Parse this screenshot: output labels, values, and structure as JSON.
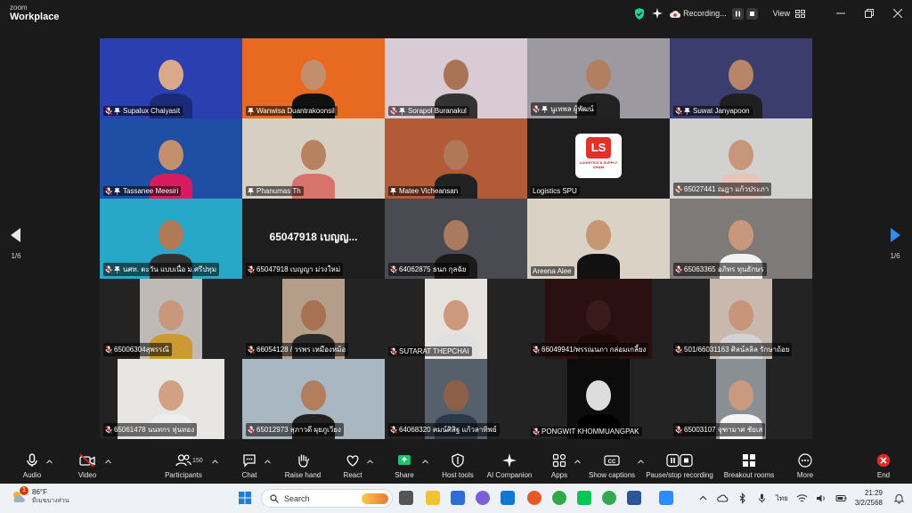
{
  "app": {
    "logo_line1": "zoom",
    "logo_line2": "Workplace"
  },
  "top": {
    "recording_label": "Recording...",
    "view_label": "View"
  },
  "nav": {
    "page_left": "1/6",
    "page_right": "1/6"
  },
  "participants": [
    {
      "name": "Supalux Chaiyasit",
      "muted": true,
      "bg": "#2a3fb0"
    },
    {
      "name": "Wanwisa Duantrakoonsil",
      "muted": false,
      "bg": "#e86a21"
    },
    {
      "name": "Sorapol Buranakul",
      "muted": true,
      "bg": "#d9cbd4"
    },
    {
      "name": "นูเทพล ผู้พัฒน์",
      "muted": true,
      "bg": "#9c9aa0"
    },
    {
      "name": "Suwat Janyapoon",
      "muted": true,
      "bg": "#3a3d6d"
    },
    {
      "name": "Tassanee Meesiri",
      "muted": true,
      "bg": "#1f4fa5"
    },
    {
      "name": "Phanumas Th",
      "muted": false,
      "bg": "#d8cfc3"
    },
    {
      "name": "Matee Vicheansan",
      "muted": false,
      "bg": "#b35b36"
    },
    {
      "name": "Logistics SPU",
      "muted": false,
      "bg": "#1e1e1e"
    },
    {
      "name": "65027441 ณฎา แก้วประภา",
      "muted": true,
      "bg": "#d1d2d0"
    },
    {
      "name": "นศท. ตะวัน แบบเนื่อ ม.ศรีปทุม",
      "muted": true,
      "bg": "#28a8c9"
    },
    {
      "name": "65047918 เบญญา ม่วงใหม่",
      "muted": true,
      "bg": "#1e1e1e"
    },
    {
      "name": "64062875 ธนภ กุลฉัย",
      "muted": true,
      "bg": "#4a4a52"
    },
    {
      "name": "Areena Alee",
      "muted": false,
      "bg": "#d9d2c5"
    },
    {
      "name": "65063365 อภิทร ทุนธักษร",
      "muted": true,
      "bg": "#7d7a78"
    },
    {
      "name": "65006304สุพรรณี",
      "muted": true,
      "bg": "#bfbab5"
    },
    {
      "name": "66054128 / วรพร เหมืองหม้อ",
      "muted": true,
      "bg": "#b49e8a"
    },
    {
      "name": "SUTARAT THEPCHAI",
      "muted": true,
      "bg": "#e6e2de"
    },
    {
      "name": "66049941/พรรณนภา กล่อมเกลี้ยง",
      "muted": true,
      "bg": "#2a1010"
    },
    {
      "name": "501/66031163 ศิลน์ลลิล รักษาถ้อย",
      "muted": true,
      "bg": "#c8b8ae"
    },
    {
      "name": "65061478 นนทกร หุ่นทอง",
      "muted": true,
      "bg": "#e8e6e2"
    },
    {
      "name": "65012973 สุภาวดี ผุยภูเวียง",
      "muted": true,
      "bg": "#a8b7c2"
    },
    {
      "name": "64068320 คมน์ศิสิฐ แก้วลาทิพย์",
      "muted": true,
      "bg": "#55606a"
    },
    {
      "name": "PONGWIT KHOMMUANGPAK",
      "muted": true,
      "bg": "#0c0c0c"
    },
    {
      "name": "65003107 จุฑามาศ ชัยเส",
      "muted": true,
      "bg": "#8a8f96"
    }
  ],
  "tiles_text": {
    "big_name": "65047918 เบญญ..."
  },
  "ls_logo": {
    "mark": "LS",
    "text": "LOGISTICS & SUPPLY CHAIN"
  },
  "toolbar": {
    "audio": "Audio",
    "video": "Video",
    "participants": "Participants",
    "participants_count": "150",
    "chat": "Chat",
    "raise_hand": "Raise hand",
    "react": "React",
    "share": "Share",
    "host_tools": "Host tools",
    "ai_companion": "AI Companion",
    "apps": "Apps",
    "show_captions": "Show captions",
    "pause_recording": "Pause/stop recording",
    "breakout_rooms": "Breakout rooms",
    "more": "More",
    "end": "End"
  },
  "taskbar": {
    "temp": "86°F",
    "weather_desc": "มีเมฆบางส่วน",
    "badge": "1",
    "search": "Search",
    "lang": "ไทย",
    "time": "21:29",
    "date": "3/2/2568"
  },
  "colors": {
    "accent_green": "#23d18b",
    "end_red": "#e02828",
    "share_green": "#1ec46b"
  }
}
